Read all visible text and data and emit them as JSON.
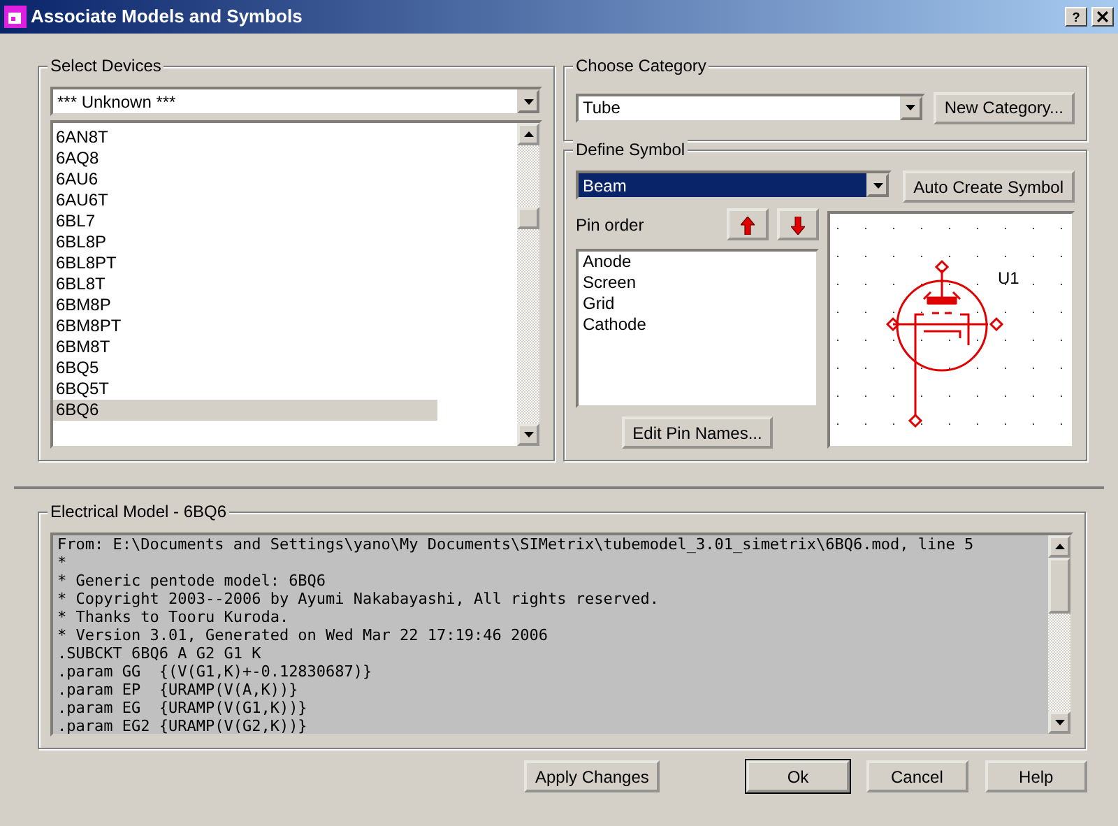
{
  "window": {
    "title": "Associate Models and Symbols",
    "help_glyph": "?"
  },
  "select_devices": {
    "label": "Select Devices",
    "filter": "*** Unknown ***",
    "items": [
      {
        "name": "6AN8T",
        "selected": false
      },
      {
        "name": "6AQ8",
        "selected": false
      },
      {
        "name": "6AU6",
        "selected": false
      },
      {
        "name": "6AU6T",
        "selected": false
      },
      {
        "name": "6BL7",
        "selected": false
      },
      {
        "name": "6BL8P",
        "selected": false
      },
      {
        "name": "6BL8PT",
        "selected": false
      },
      {
        "name": "6BL8T",
        "selected": false
      },
      {
        "name": "6BM8P",
        "selected": false
      },
      {
        "name": "6BM8PT",
        "selected": false
      },
      {
        "name": "6BM8T",
        "selected": false
      },
      {
        "name": "6BQ5",
        "selected": false
      },
      {
        "name": "6BQ5T",
        "selected": false
      },
      {
        "name": "6BQ6",
        "selected": true
      }
    ]
  },
  "choose_category": {
    "label": "Choose Category",
    "value": "Tube",
    "button": "New Category..."
  },
  "define_symbol": {
    "label": "Define Symbol",
    "symbol": "Beam",
    "auto_button": "Auto Create Symbol",
    "pin_order_label": "Pin order",
    "pins": [
      "Anode",
      "Screen",
      "Grid",
      "Cathode"
    ],
    "edit_button": "Edit Pin Names...",
    "preview_ref": "U1"
  },
  "electrical_model": {
    "label": "Electrical Model - 6BQ6",
    "lines": [
      "From: E:\\Documents and Settings\\yano\\My Documents\\SIMetrix\\tubemodel_3.01_simetrix\\6BQ6.mod, line 5",
      "*",
      "* Generic pentode model: 6BQ6",
      "* Copyright 2003--2006 by Ayumi Nakabayashi, All rights reserved.",
      "* Thanks to Tooru Kuroda.",
      "* Version 3.01, Generated on Wed Mar 22 17:19:46 2006",
      ".SUBCKT 6BQ6 A G2 G1 K",
      ".param GG  {(V(G1,K)+-0.12830687)}",
      ".param EP  {URAMP(V(A,K))}",
      ".param EG  {URAMP(V(G1,K))}",
      ".param EG2 {URAMP(V(G2,K))}"
    ]
  },
  "buttons": [
    {
      "label": "Apply Changes",
      "kind": "apply"
    },
    {
      "label": "Ok",
      "kind": "default"
    },
    {
      "label": "Cancel",
      "kind": "normal"
    },
    {
      "label": "Help",
      "kind": "normal"
    }
  ]
}
